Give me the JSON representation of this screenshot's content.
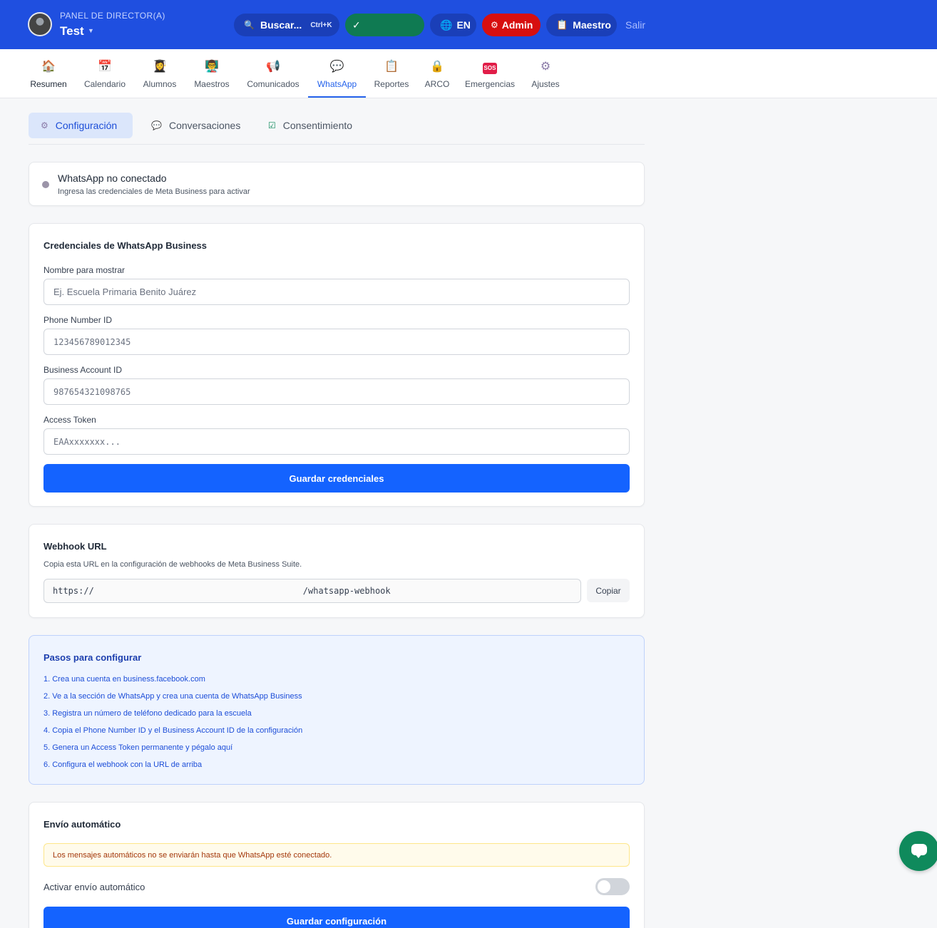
{
  "header": {
    "panel_label": "PANEL DE DIRECTOR(A)",
    "user_name": "Test",
    "search_label": "Buscar...",
    "search_shortcut": "Ctrl+K",
    "status_check": "✓",
    "lang_label": "EN",
    "admin_label": "Admin",
    "teacher_label": "Maestro",
    "logout_label": "Salir"
  },
  "nav": {
    "items": [
      {
        "label": "Resumen",
        "icon": "home-icon",
        "glyph": "🏠"
      },
      {
        "label": "Calendario",
        "icon": "calendar-icon",
        "glyph": "📅"
      },
      {
        "label": "Alumnos",
        "icon": "student-icon",
        "glyph": "👩‍🎓"
      },
      {
        "label": "Maestros",
        "icon": "teachers-icon",
        "glyph": "👨‍🏫"
      },
      {
        "label": "Comunicados",
        "icon": "megaphone-icon",
        "glyph": "📢"
      },
      {
        "label": "WhatsApp",
        "icon": "chat-bubble-icon",
        "glyph": "💬"
      },
      {
        "label": "Reportes",
        "icon": "clipboard-icon",
        "glyph": "📋"
      },
      {
        "label": "ARCO",
        "icon": "lock-icon",
        "glyph": "🔒"
      },
      {
        "label": "Emergencias",
        "icon": "sos-icon",
        "glyph": "SOS"
      },
      {
        "label": "Ajustes",
        "icon": "gear-icon",
        "glyph": "⚙"
      }
    ],
    "active": "WhatsApp"
  },
  "subtabs": {
    "config": "Configuración",
    "conversations": "Conversaciones",
    "consent": "Consentimiento"
  },
  "status": {
    "title": "WhatsApp no conectado",
    "subtitle": "Ingresa las credenciales de Meta Business para activar"
  },
  "credentials": {
    "title": "Credenciales de WhatsApp Business",
    "display_name_label": "Nombre para mostrar",
    "display_name_placeholder": "Ej. Escuela Primaria Benito Juárez",
    "phone_id_label": "Phone Number ID",
    "phone_id_placeholder": "123456789012345",
    "business_id_label": "Business Account ID",
    "business_id_placeholder": "987654321098765",
    "token_label": "Access Token",
    "token_placeholder": "EAAxxxxxxx...",
    "save_label": "Guardar credenciales"
  },
  "webhook": {
    "title": "Webhook URL",
    "description": "Copia esta URL en la configuración de webhooks de Meta Business Suite.",
    "url_prefix": "https://",
    "url_suffix": "/whatsapp-webhook",
    "copy_label": "Copiar"
  },
  "steps": {
    "title": "Pasos para configurar",
    "items": [
      "1. Crea una cuenta en business.facebook.com",
      "2. Ve a la sección de WhatsApp y crea una cuenta de WhatsApp Business",
      "3. Registra un número de teléfono dedicado para la escuela",
      "4. Copia el Phone Number ID y el Business Account ID de la configuración",
      "5. Genera un Access Token permanente y pégalo aquí",
      "6. Configura el webhook con la URL de arriba"
    ]
  },
  "auto_send": {
    "title": "Envío automático",
    "warning": "Los mensajes automáticos no se enviarán hasta que WhatsApp esté conectado.",
    "toggle_label": "Activar envío automático",
    "toggle_on": false,
    "save_label": "Guardar configuración"
  },
  "colors": {
    "header_bg": "#1f4fe0",
    "primary": "#1463ff",
    "admin": "#d70f0f",
    "status_ok": "#0f7a52",
    "chat_fab": "#0f8a5c"
  }
}
